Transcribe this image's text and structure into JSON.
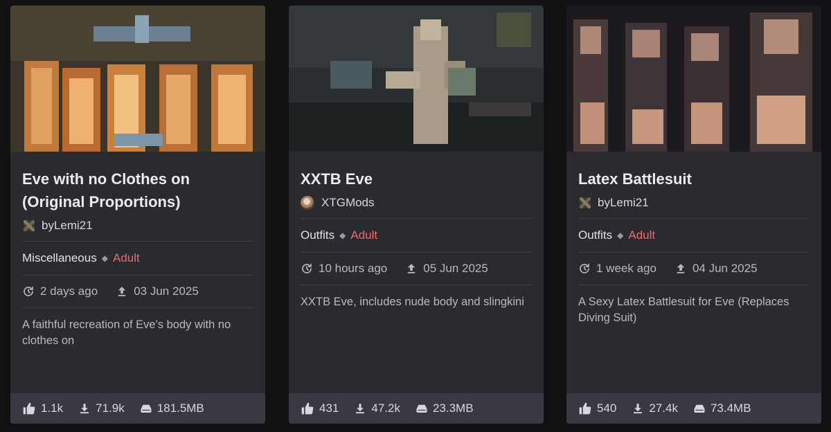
{
  "cards": [
    {
      "title_line1": "Eve with no Clothes on",
      "title_line2": "(Original Proportions)",
      "author": "byLemi21",
      "category": "Miscellaneous",
      "content_rating": "Adult",
      "updated": "2 days ago",
      "uploaded": "03 Jun 2025",
      "description": "A faithful recreation of Eve's body with no clothes on",
      "likes": "1.1k",
      "downloads": "71.9k",
      "size": "181.5MB",
      "thumbnail_icon": "censored-thumbnail-image"
    },
    {
      "title_line1": "XXTB Eve",
      "title_line2": "",
      "author": "XTGMods",
      "category": "Outfits",
      "content_rating": "Adult",
      "updated": "10 hours ago",
      "uploaded": "05 Jun 2025",
      "description": "XXTB Eve, includes nude body and slingkini",
      "likes": "431",
      "downloads": "47.2k",
      "size": "23.3MB",
      "thumbnail_icon": "censored-thumbnail-image"
    },
    {
      "title_line1": "Latex Battlesuit",
      "title_line2": "",
      "author": "byLemi21",
      "category": "Outfits",
      "content_rating": "Adult",
      "updated": "1 week ago",
      "uploaded": "04 Jun 2025",
      "description": "A Sexy Latex Battlesuit for Eve (Replaces Diving Suit)",
      "likes": "540",
      "downloads": "27.4k",
      "size": "73.4MB",
      "thumbnail_icon": "censored-thumbnail-image"
    }
  ],
  "colors": {
    "background": "#111113",
    "card": "#2a2a31",
    "footer": "#393941",
    "adult": "#f2686a",
    "divider": "#414149"
  },
  "icons": {
    "updated": "refresh-clock-icon",
    "uploaded": "upload-arrow-icon",
    "likes": "thumbs-up-icon",
    "downloads": "download-arrow-icon",
    "size": "hard-drive-icon"
  }
}
